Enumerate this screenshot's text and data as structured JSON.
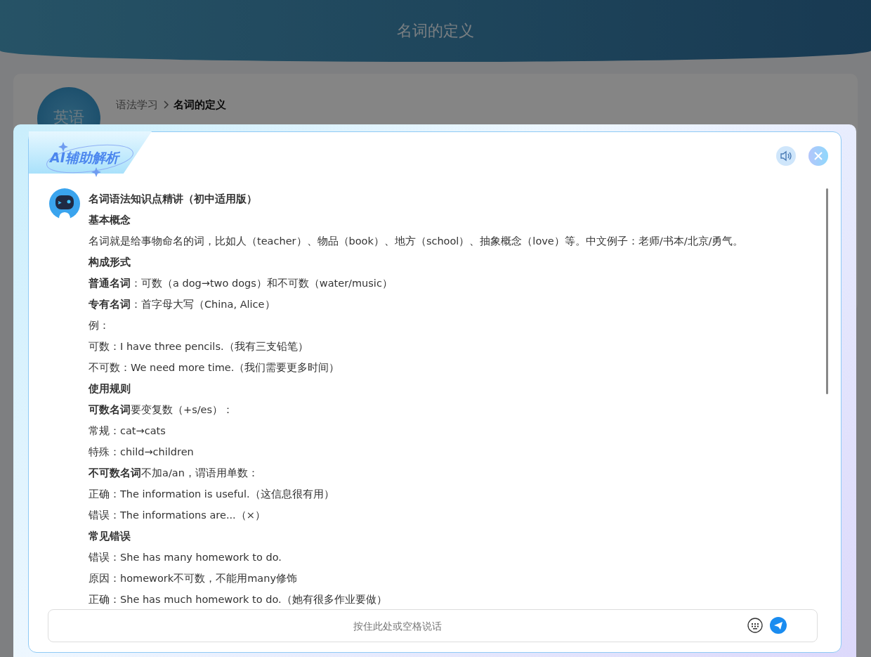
{
  "header": {
    "title": "名词的定义"
  },
  "card": {
    "badge": "英语",
    "breadcrumb": [
      {
        "label": "语法学习",
        "selected": false
      },
      {
        "label": "名词的定义",
        "selected": true
      }
    ]
  },
  "dialog": {
    "title": "AI辅助解析",
    "lines": [
      {
        "kind": "heading",
        "text": "名词语法知识点精讲（初中适用版）"
      },
      {
        "kind": "heading",
        "text": "基本概念"
      },
      {
        "kind": "text",
        "text": "名词就是给事物命名的词，比如人（teacher）、物品（book）、地方（school）、抽象概念（love）等。中文例子：老师/书本/北京/勇气。"
      },
      {
        "kind": "heading",
        "text": "构成形式"
      },
      {
        "kind": "text",
        "text": "**普通名词**：可数（a dog→two dogs）和不可数（water/music）"
      },
      {
        "kind": "text",
        "text": "**专有名词**：首字母大写（China, Alice）"
      },
      {
        "kind": "text",
        "text": "例："
      },
      {
        "kind": "text",
        "text": "可数：I have three pencils.（我有三支铅笔）"
      },
      {
        "kind": "text",
        "text": "不可数：We need more time.（我们需要更多时间）"
      },
      {
        "kind": "heading",
        "text": "使用规则"
      },
      {
        "kind": "text",
        "text": "**可数名词**要变复数（+s/es）："
      },
      {
        "kind": "text",
        "text": "常规：cat→cats"
      },
      {
        "kind": "text",
        "text": "特殊：child→children"
      },
      {
        "kind": "text",
        "text": "**不可数名词**不加a/an，谓语用单数："
      },
      {
        "kind": "text",
        "text": "正确：The information is useful.（这信息很有用）"
      },
      {
        "kind": "text",
        "text": "错误：The informations are...（×）"
      },
      {
        "kind": "heading",
        "text": "常见错误"
      },
      {
        "kind": "text",
        "text": "错误：She has many homework to do."
      },
      {
        "kind": "text",
        "text": "原因：homework不可数，不能用many修饰"
      },
      {
        "kind": "text",
        "text": "正确：She has much homework to do.（她有很多作业要做）"
      }
    ],
    "input": {
      "placeholder": "按住此处或空格说话"
    }
  }
}
